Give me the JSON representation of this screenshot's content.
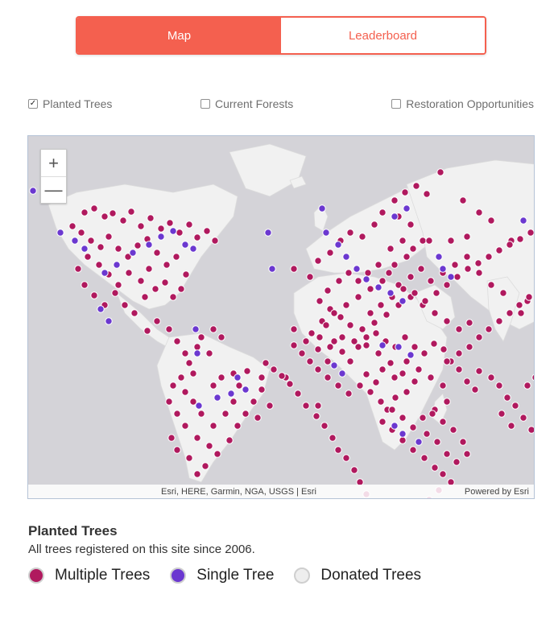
{
  "tabs": [
    {
      "label": "Map",
      "active": true
    },
    {
      "label": "Leaderboard",
      "active": false
    }
  ],
  "filters": [
    {
      "label": "Planted Trees",
      "checked": true
    },
    {
      "label": "Current Forests",
      "checked": false
    },
    {
      "label": "Restoration Opportunities",
      "checked": false
    }
  ],
  "map": {
    "zoom_in": "+",
    "zoom_out": "—",
    "attribution": "Esri, HERE, Garmin, NGA, USGS | Esri",
    "powered_by": "Powered by Esri",
    "colors": {
      "water": "#d4d3d8",
      "land": "#f1f1f1",
      "multiple": "#b0195e",
      "single": "#6b38d0",
      "donated": "#eeeeee"
    },
    "markers": {
      "multiple": [
        [
          70,
          95
        ],
        [
          82,
          90
        ],
        [
          95,
          100
        ],
        [
          105,
          96
        ],
        [
          118,
          105
        ],
        [
          128,
          94
        ],
        [
          140,
          112
        ],
        [
          152,
          102
        ],
        [
          165,
          115
        ],
        [
          176,
          108
        ],
        [
          188,
          120
        ],
        [
          200,
          110
        ],
        [
          210,
          126
        ],
        [
          222,
          118
        ],
        [
          232,
          130
        ],
        [
          55,
          112
        ],
        [
          66,
          120
        ],
        [
          78,
          130
        ],
        [
          90,
          138
        ],
        [
          100,
          125
        ],
        [
          112,
          140
        ],
        [
          124,
          150
        ],
        [
          136,
          136
        ],
        [
          148,
          128
        ],
        [
          160,
          145
        ],
        [
          172,
          160
        ],
        [
          184,
          150
        ],
        [
          196,
          172
        ],
        [
          150,
          165
        ],
        [
          140,
          180
        ],
        [
          125,
          170
        ],
        [
          112,
          185
        ],
        [
          100,
          172
        ],
        [
          88,
          160
        ],
        [
          74,
          150
        ],
        [
          62,
          165
        ],
        [
          70,
          185
        ],
        [
          82,
          198
        ],
        [
          95,
          210
        ],
        [
          108,
          195
        ],
        [
          120,
          210
        ],
        [
          132,
          220
        ],
        [
          145,
          200
        ],
        [
          158,
          190
        ],
        [
          170,
          182
        ],
        [
          180,
          200
        ],
        [
          190,
          190
        ],
        [
          160,
          230
        ],
        [
          148,
          242
        ],
        [
          175,
          240
        ],
        [
          185,
          255
        ],
        [
          195,
          270
        ],
        [
          200,
          282
        ],
        [
          215,
          250
        ],
        [
          230,
          240
        ],
        [
          240,
          250
        ],
        [
          225,
          270
        ],
        [
          210,
          262
        ],
        [
          205,
          295
        ],
        [
          190,
          300
        ],
        [
          180,
          310
        ],
        [
          175,
          330
        ],
        [
          185,
          345
        ],
        [
          195,
          360
        ],
        [
          210,
          375
        ],
        [
          225,
          385
        ],
        [
          235,
          395
        ],
        [
          250,
          378
        ],
        [
          260,
          360
        ],
        [
          270,
          345
        ],
        [
          280,
          330
        ],
        [
          290,
          315
        ],
        [
          255,
          330
        ],
        [
          245,
          345
        ],
        [
          230,
          360
        ],
        [
          215,
          345
        ],
        [
          205,
          330
        ],
        [
          195,
          318
        ],
        [
          230,
          310
        ],
        [
          262,
          310
        ],
        [
          290,
          300
        ],
        [
          272,
          292
        ],
        [
          255,
          295
        ],
        [
          240,
          300
        ],
        [
          220,
          410
        ],
        [
          210,
          420
        ],
        [
          200,
          400
        ],
        [
          185,
          390
        ],
        [
          178,
          375
        ],
        [
          320,
          300
        ],
        [
          285,
          350
        ],
        [
          300,
          335
        ],
        [
          330,
          165
        ],
        [
          360,
          335
        ],
        [
          380,
          255
        ],
        [
          390,
          268
        ],
        [
          400,
          280
        ],
        [
          410,
          262
        ],
        [
          420,
          250
        ],
        [
          432,
          245
        ],
        [
          444,
          255
        ],
        [
          456,
          262
        ],
        [
          468,
          250
        ],
        [
          480,
          262
        ],
        [
          492,
          270
        ],
        [
          504,
          258
        ],
        [
          516,
          265
        ],
        [
          525,
          280
        ],
        [
          535,
          290
        ],
        [
          545,
          305
        ],
        [
          555,
          315
        ],
        [
          560,
          292
        ],
        [
          575,
          300
        ],
        [
          585,
          310
        ],
        [
          595,
          325
        ],
        [
          605,
          335
        ],
        [
          615,
          350
        ],
        [
          625,
          365
        ],
        [
          620,
          310
        ],
        [
          630,
          300
        ],
        [
          588,
          345
        ],
        [
          600,
          360
        ],
        [
          575,
          185
        ],
        [
          590,
          195
        ],
        [
          612,
          220
        ],
        [
          620,
          205
        ],
        [
          560,
          170
        ],
        [
          545,
          150
        ],
        [
          530,
          160
        ],
        [
          515,
          170
        ],
        [
          500,
          180
        ],
        [
          488,
          165
        ],
        [
          475,
          175
        ],
        [
          460,
          185
        ],
        [
          448,
          170
        ],
        [
          435,
          160
        ],
        [
          422,
          170
        ],
        [
          410,
          180
        ],
        [
          398,
          170
        ],
        [
          386,
          180
        ],
        [
          372,
          192
        ],
        [
          362,
          205
        ],
        [
          375,
          215
        ],
        [
          388,
          225
        ],
        [
          400,
          235
        ],
        [
          415,
          240
        ],
        [
          430,
          232
        ],
        [
          445,
          222
        ],
        [
          460,
          210
        ],
        [
          475,
          200
        ],
        [
          490,
          210
        ],
        [
          505,
          220
        ],
        [
          520,
          230
        ],
        [
          535,
          240
        ],
        [
          548,
          232
        ],
        [
          450,
          140
        ],
        [
          465,
          130
        ],
        [
          478,
          140
        ],
        [
          490,
          130
        ],
        [
          440,
          95
        ],
        [
          455,
          80
        ],
        [
          468,
          70
        ],
        [
          482,
          62
        ],
        [
          495,
          72
        ],
        [
          460,
          100
        ],
        [
          475,
          110
        ],
        [
          430,
          110
        ],
        [
          415,
          125
        ],
        [
          400,
          120
        ],
        [
          388,
          130
        ],
        [
          375,
          145
        ],
        [
          360,
          155
        ],
        [
          350,
          175
        ],
        [
          365,
          230
        ],
        [
          352,
          245
        ],
        [
          360,
          265
        ],
        [
          372,
          280
        ],
        [
          330,
          240
        ],
        [
          345,
          255
        ],
        [
          540,
          80
        ],
        [
          512,
          45
        ],
        [
          560,
          95
        ],
        [
          575,
          105
        ],
        [
          600,
          130
        ],
        [
          545,
          125
        ],
        [
          525,
          130
        ],
        [
          498,
          130
        ],
        [
          470,
          150
        ],
        [
          455,
          160
        ],
        [
          440,
          180
        ],
        [
          425,
          190
        ],
        [
          410,
          200
        ],
        [
          395,
          210
        ],
        [
          380,
          220
        ],
        [
          370,
          235
        ],
        [
          362,
          250
        ],
        [
          375,
          262
        ],
        [
          390,
          250
        ],
        [
          405,
          255
        ],
        [
          420,
          260
        ],
        [
          435,
          270
        ],
        [
          450,
          282
        ],
        [
          465,
          295
        ],
        [
          480,
          305
        ],
        [
          470,
          318
        ],
        [
          456,
          325
        ],
        [
          446,
          340
        ],
        [
          440,
          355
        ],
        [
          452,
          365
        ],
        [
          465,
          378
        ],
        [
          478,
          390
        ],
        [
          492,
          400
        ],
        [
          505,
          412
        ],
        [
          515,
          420
        ],
        [
          525,
          430
        ],
        [
          510,
          440
        ],
        [
          498,
          452
        ],
        [
          485,
          460
        ],
        [
          475,
          472
        ],
        [
          460,
          485
        ],
        [
          448,
          492
        ],
        [
          438,
          478
        ],
        [
          428,
          462
        ],
        [
          420,
          445
        ],
        [
          412,
          430
        ],
        [
          405,
          415
        ],
        [
          395,
          400
        ],
        [
          385,
          390
        ],
        [
          378,
          375
        ],
        [
          368,
          360
        ],
        [
          358,
          348
        ],
        [
          345,
          335
        ],
        [
          335,
          320
        ],
        [
          325,
          308
        ],
        [
          315,
          298
        ],
        [
          305,
          290
        ],
        [
          295,
          282
        ],
        [
          420,
          296
        ],
        [
          432,
          306
        ],
        [
          440,
          290
        ],
        [
          455,
          300
        ],
        [
          470,
          280
        ],
        [
          485,
          290
        ],
        [
          500,
          300
        ],
        [
          515,
          310
        ],
        [
          520,
          330
        ],
        [
          505,
          340
        ],
        [
          490,
          350
        ],
        [
          478,
          362
        ],
        [
          465,
          350
        ],
        [
          452,
          340
        ],
        [
          438,
          330
        ],
        [
          425,
          318
        ],
        [
          412,
          310
        ],
        [
          398,
          320
        ],
        [
          385,
          310
        ],
        [
          372,
          300
        ],
        [
          360,
          290
        ],
        [
          350,
          280
        ],
        [
          340,
          270
        ],
        [
          330,
          260
        ],
        [
          495,
          370
        ],
        [
          508,
          380
        ],
        [
          520,
          395
        ],
        [
          532,
          405
        ],
        [
          545,
          395
        ],
        [
          540,
          380
        ],
        [
          528,
          365
        ],
        [
          515,
          355
        ],
        [
          502,
          345
        ],
        [
          520,
          280
        ],
        [
          535,
          270
        ],
        [
          548,
          262
        ],
        [
          560,
          250
        ],
        [
          572,
          240
        ],
        [
          585,
          230
        ],
        [
          598,
          220
        ],
        [
          610,
          210
        ],
        [
          622,
          200
        ],
        [
          635,
          190
        ],
        [
          645,
          180
        ],
        [
          425,
          220
        ],
        [
          438,
          210
        ],
        [
          452,
          200
        ],
        [
          466,
          190
        ],
        [
          480,
          195
        ],
        [
          493,
          205
        ],
        [
          507,
          195
        ],
        [
          520,
          185
        ],
        [
          533,
          175
        ],
        [
          546,
          165
        ],
        [
          559,
          158
        ],
        [
          572,
          150
        ],
        [
          585,
          142
        ],
        [
          598,
          135
        ],
        [
          611,
          128
        ],
        [
          624,
          120
        ],
        [
          637,
          112
        ]
      ],
      "single": [
        [
          6,
          68
        ],
        [
          40,
          120
        ],
        [
          58,
          130
        ],
        [
          70,
          140
        ],
        [
          95,
          170
        ],
        [
          110,
          160
        ],
        [
          130,
          145
        ],
        [
          150,
          135
        ],
        [
          165,
          125
        ],
        [
          180,
          118
        ],
        [
          195,
          135
        ],
        [
          205,
          140
        ],
        [
          90,
          215
        ],
        [
          100,
          230
        ],
        [
          208,
          240
        ],
        [
          210,
          270
        ],
        [
          212,
          335
        ],
        [
          235,
          325
        ],
        [
          252,
          320
        ],
        [
          270,
          315
        ],
        [
          260,
          300
        ],
        [
          298,
          120
        ],
        [
          303,
          165
        ],
        [
          365,
          90
        ],
        [
          370,
          120
        ],
        [
          385,
          135
        ],
        [
          395,
          150
        ],
        [
          408,
          165
        ],
        [
          420,
          178
        ],
        [
          435,
          188
        ],
        [
          450,
          195
        ],
        [
          465,
          205
        ],
        [
          515,
          165
        ],
        [
          525,
          175
        ],
        [
          510,
          150
        ],
        [
          615,
          105
        ],
        [
          455,
          100
        ],
        [
          470,
          90
        ],
        [
          440,
          260
        ],
        [
          460,
          262
        ],
        [
          475,
          272
        ],
        [
          455,
          360
        ],
        [
          465,
          370
        ],
        [
          380,
          285
        ],
        [
          390,
          295
        ],
        [
          485,
          380
        ]
      ]
    }
  },
  "legend": {
    "title": "Planted Trees",
    "subtitle": "All trees registered on this site since 2006.",
    "items": [
      {
        "label": "Multiple Trees",
        "color": "#b0195e"
      },
      {
        "label": "Single Tree",
        "color": "#6b38d0"
      },
      {
        "label": "Donated Trees",
        "color": "#eeeeee"
      }
    ]
  }
}
